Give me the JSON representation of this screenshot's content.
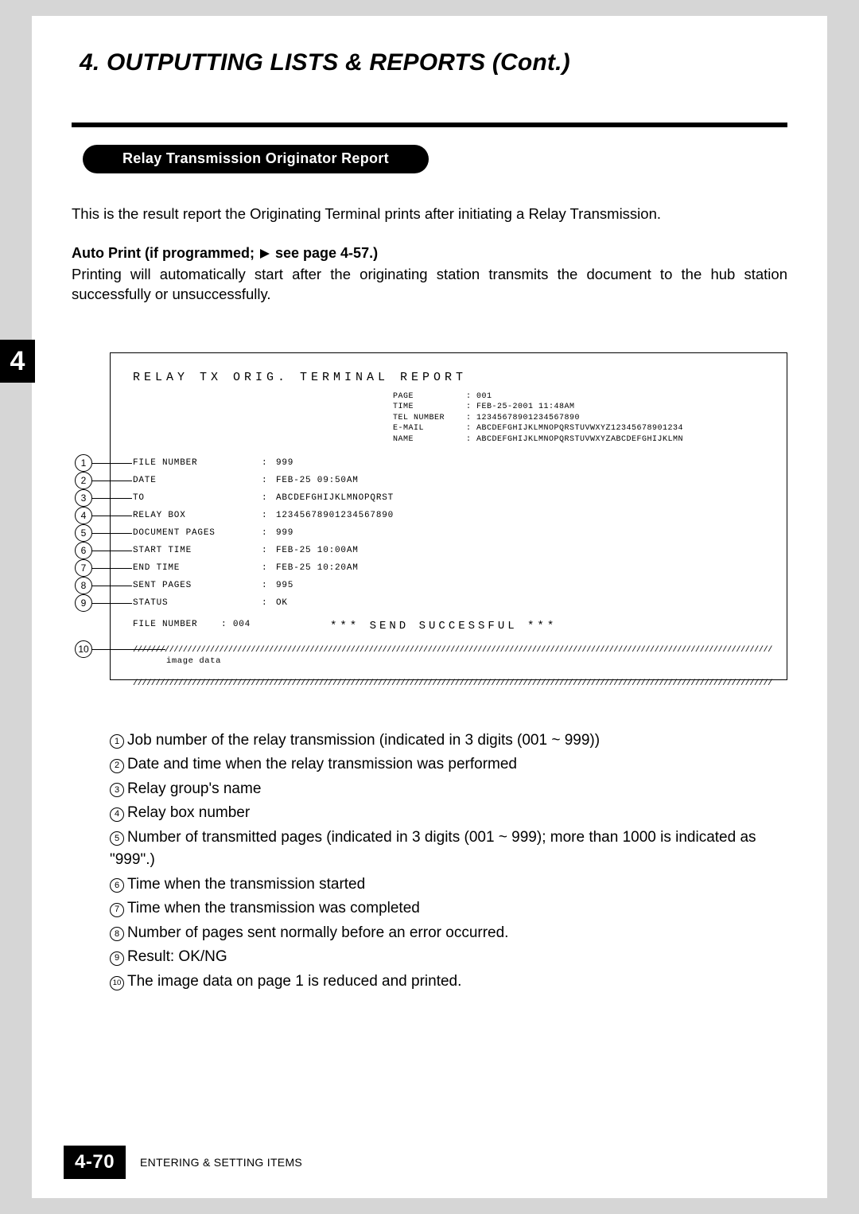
{
  "heading": "4. OUTPUTTING LISTS & REPORTS (Cont.)",
  "section_title": "Relay Transmission Originator Report",
  "intro": "This is the result report the Originating Terminal prints after initiating a Relay Transmission.",
  "auto_print": {
    "prefix": "Auto Print (if programmed; ",
    "suffix": " see page 4-57.)",
    "body": "Printing will automatically start after the originating station transmits the document to the hub station successfully or unsuccessfully."
  },
  "tab": "4",
  "report": {
    "title": "RELAY TX ORIG. TERMINAL REPORT",
    "header": {
      "page_label": "PAGE",
      "page_value": "001",
      "time_label": "TIME",
      "time_value": "FEB-25-2001  11:48AM",
      "tel_label": "TEL NUMBER",
      "tel_value": "12345678901234567890",
      "email_label": "E-MAIL",
      "email_value": "ABCDEFGHIJKLMNOPQRSTUVWXYZ12345678901234",
      "name_label": "NAME",
      "name_value": "ABCDEFGHIJKLMNOPQRSTUVWXYZABCDEFGHIJKLMN"
    },
    "rows": [
      {
        "label": "FILE NUMBER",
        "value": "999"
      },
      {
        "label": "DATE",
        "value": "FEB-25 09:50AM"
      },
      {
        "label": "TO",
        "value": "ABCDEFGHIJKLMNOPQRST"
      },
      {
        "label": "RELAY BOX",
        "value": "12345678901234567890"
      },
      {
        "label": "DOCUMENT PAGES",
        "value": "999"
      },
      {
        "label": "START TIME",
        "value": "FEB-25  10:00AM"
      },
      {
        "label": "END TIME",
        "value": "FEB-25  10:20AM"
      },
      {
        "label": "SENT PAGES",
        "value": "995"
      },
      {
        "label": "STATUS",
        "value": "OK"
      }
    ],
    "status_file_number_label": "FILE NUMBER",
    "status_file_number_value": "004",
    "send_successful": "***  SEND SUCCESSFUL  ***",
    "image_data_label": "image data",
    "hash": "//////////////////////////////////////////////////////////////////////////////////////////////////////////////////////////////////////////////////"
  },
  "legend": [
    "Job number of the relay transmission (indicated in 3 digits (001 ~ 999))",
    "Date and time when the relay transmission was performed",
    "Relay group's name",
    "Relay box number",
    "Number of transmitted pages (indicated in 3 digits (001 ~ 999); more than 1000 is indicated as \"999\".)",
    "Time when the transmission started",
    "Time when the transmission was completed",
    "Number of pages sent normally before an error occurred.",
    "Result:  OK/NG",
    "The image data on page 1 is reduced and printed."
  ],
  "footer": {
    "page_number": "4-70",
    "text": "ENTERING & SETTING ITEMS"
  }
}
